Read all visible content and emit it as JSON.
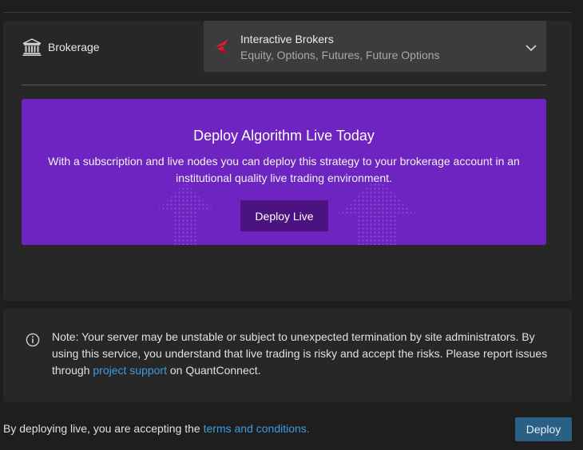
{
  "brokerage": {
    "label": "Brokerage",
    "icon": "bank-icon",
    "selected_name": "Interactive Brokers",
    "selected_description": "Equity, Options, Futures, Future Options",
    "logo_icon": "interactive-brokers-logo",
    "logo_color": "#d8202f"
  },
  "promo": {
    "title": "Deploy Algorithm Live Today",
    "text": "With a subscription and live nodes you can deploy this strategy to your brokerage account in an institutional quality live trading environment.",
    "button_label": "Deploy Live",
    "background_color": "#6d24c1"
  },
  "note": {
    "icon": "info-icon",
    "text_before": "Note: Your server may be unstable or subject to unexpected termination by site administrators. By using this service, you understand that live trading is risky and accept the risks. Please report issues through ",
    "link_label": "project support",
    "text_after": " on QuantConnect."
  },
  "footer": {
    "text_before": "By deploying live, you are accepting the ",
    "link_label": "terms and conditions.",
    "deploy_label": "Deploy"
  },
  "colors": {
    "link": "#3d9be0",
    "deploy_button": "#2a5f86"
  }
}
